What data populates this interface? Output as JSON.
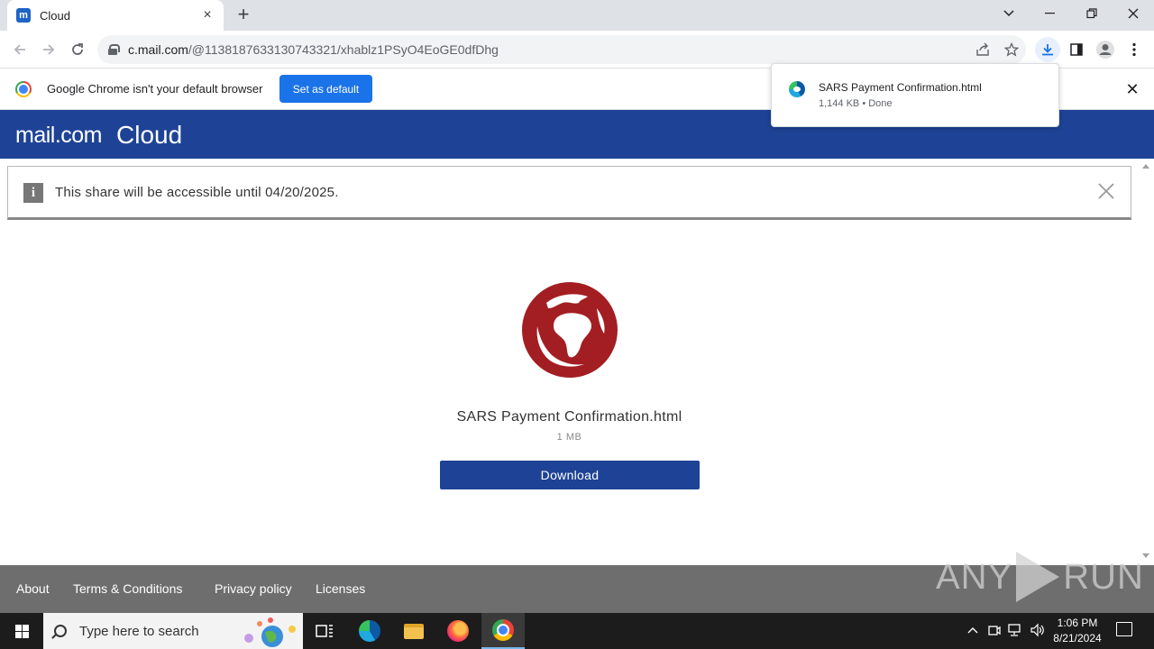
{
  "browser": {
    "tab": {
      "title": "Cloud",
      "favicon": "m"
    },
    "url": {
      "host": "c.mail.com",
      "path": "/@1138187633130743321/xhablz1PSyO4EoGE0dfDhg"
    },
    "infobar": {
      "message": "Google Chrome isn't your default browser",
      "button": "Set as default"
    },
    "download_bubble": {
      "file_name": "SARS Payment Confirmation.html",
      "status": "1,144 KB • Done"
    }
  },
  "site": {
    "logo_text": "mail.com",
    "product": "Cloud",
    "accent_color": "#1e4396",
    "notice": {
      "text": "This share will be accessible until 04/20/2025."
    },
    "file": {
      "name": "SARS Payment Confirmation.html",
      "size": "1 MB",
      "download_label": "Download",
      "icon": "globe-icon"
    },
    "footer": {
      "links": [
        "About",
        "Terms & Conditions",
        "Privacy policy",
        "Licenses"
      ]
    },
    "watermark": {
      "left": "ANY",
      "right": "RUN"
    }
  },
  "taskbar": {
    "search_placeholder": "Type here to search",
    "time": "1:06 PM",
    "date": "8/21/2024"
  }
}
